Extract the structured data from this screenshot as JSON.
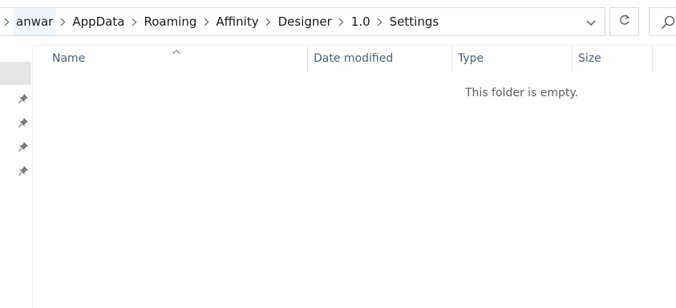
{
  "breadcrumb": {
    "items": [
      "anwar",
      "AppData",
      "Roaming",
      "Affinity",
      "Designer",
      "1.0",
      "Settings"
    ]
  },
  "icons": {
    "history": "chevron-down-icon",
    "refresh": "refresh-icon",
    "search": "search-icon",
    "pin": "pin-icon",
    "sort": "sort-ascending-caret-icon"
  },
  "columns": {
    "name": "Name",
    "date_modified": "Date modified",
    "type": "Type",
    "size": "Size"
  },
  "content": {
    "empty_message": "This folder is empty."
  },
  "colors": {
    "header_text": "#4c607a",
    "selection": "#e5e5e5",
    "crumb_hover": "#f0f5fb"
  }
}
